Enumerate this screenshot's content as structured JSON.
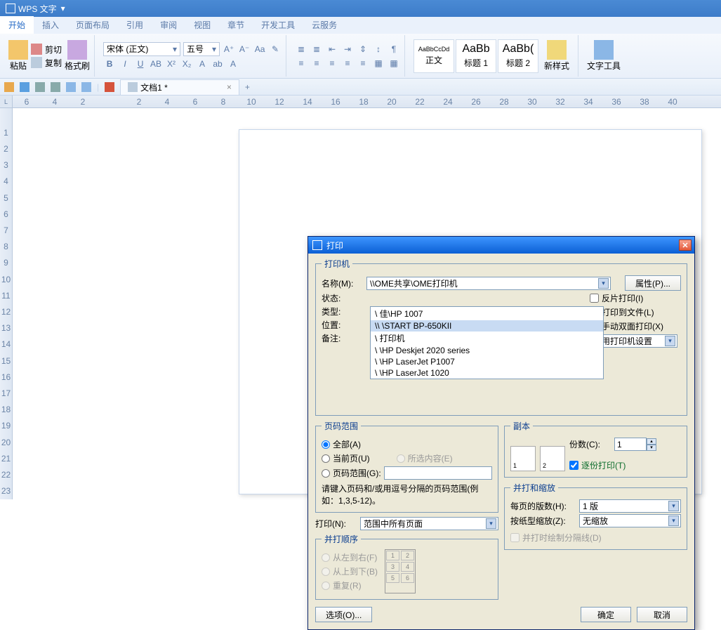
{
  "app": {
    "name": "WPS 文字"
  },
  "menu": {
    "tabs": [
      "开始",
      "插入",
      "页面布局",
      "引用",
      "审阅",
      "视图",
      "章节",
      "开发工具",
      "云服务"
    ],
    "active_index": 0
  },
  "ribbon": {
    "paste": "粘贴",
    "cut": "剪切",
    "copy": "复制",
    "format_painter": "格式刷",
    "font_name": "宋体 (正文)",
    "font_size": "五号",
    "styles": [
      {
        "preview": "AaBbCcDd",
        "label": "正文"
      },
      {
        "preview": "AaBb",
        "label": "标题 1"
      },
      {
        "preview": "AaBb(",
        "label": "标题 2"
      }
    ],
    "new_style": "新样式",
    "text_tools": "文字工具"
  },
  "qat": {
    "doc_tab": "文档1 *"
  },
  "ruler_h": [
    "6",
    "4",
    "2",
    "",
    "2",
    "4",
    "6",
    "8",
    "10",
    "12",
    "14",
    "16",
    "18",
    "20",
    "22",
    "24",
    "26",
    "28",
    "30",
    "32",
    "34",
    "36",
    "38",
    "40"
  ],
  "ruler_v": [
    "",
    "1",
    "2",
    "3",
    "4",
    "5",
    "6",
    "7",
    "8",
    "9",
    "10",
    "11",
    "12",
    "13",
    "14",
    "15",
    "16",
    "17",
    "18",
    "19",
    "20",
    "21",
    "22",
    "23"
  ],
  "corner": "L",
  "dialog": {
    "title": "打印",
    "printer_section": "打印机",
    "name_label": "名称(M):",
    "name_value": "\\\\OME共享\\OME打印机",
    "status_label": "状态:",
    "type_label": "类型:",
    "location_label": "位置:",
    "comment_label": "备注:",
    "printer_options": [
      "\\                佳\\HP 1007",
      "\\\\            \\START BP-650KII",
      "\\                  打印机",
      "\\              \\HP Deskjet 2020 series",
      "\\              \\HP LaserJet P1007",
      "\\              \\HP LaserJet 1020"
    ],
    "selected_printer_index": 1,
    "properties_btn": "属性(P)...",
    "reverse_print": "反片打印(I)",
    "print_to_file": "打印到文件(L)",
    "manual_duplex": "手动双面打印(X)",
    "use_printer_settings": "使用打印机设置",
    "page_range_section": "页码范围",
    "range_all": "全部(A)",
    "range_current": "当前页(U)",
    "range_selection": "所选内容(E)",
    "range_pages": "页码范围(G):",
    "range_hint": "请键入页码和/或用逗号分隔的页码范围(例如：1,3,5-12)。",
    "copies_section": "副本",
    "copies_label": "份数(C):",
    "copies_value": "1",
    "collate": "逐份打印(T)",
    "print_label": "打印(N):",
    "print_what": "范围中所有页面",
    "print_order_section": "并打顺序",
    "order_lr": "从左到右(F)",
    "order_tb": "从上到下(B)",
    "order_repeat": "重复(R)",
    "scale_section": "并打和缩放",
    "pages_per_sheet_label": "每页的版数(H):",
    "pages_per_sheet": "1 版",
    "scale_label": "按纸型缩放(Z):",
    "scale_value": "无缩放",
    "draw_separator": "并打时绘制分隔线(D)",
    "options_btn": "选项(O)...",
    "ok_btn": "确定",
    "cancel_btn": "取消"
  }
}
